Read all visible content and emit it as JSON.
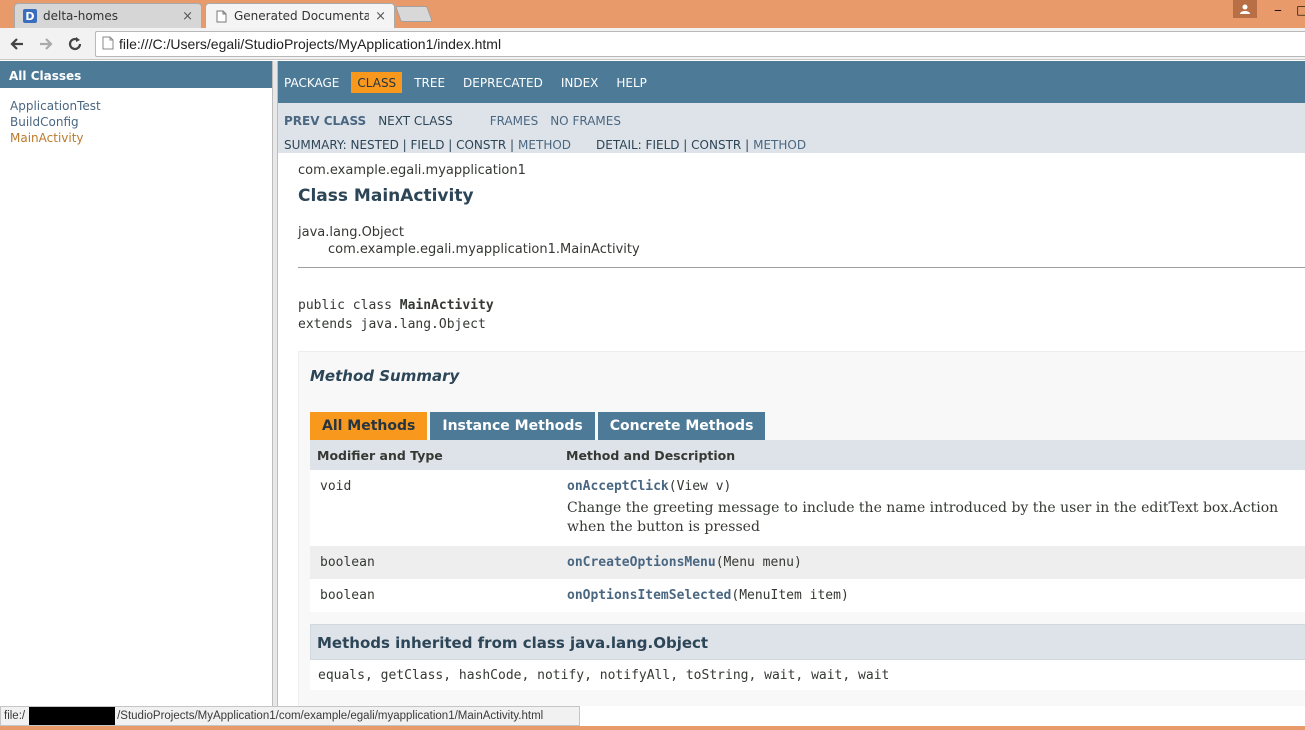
{
  "browser": {
    "tabs": [
      {
        "favicon_letter": "D",
        "title": "delta-homes",
        "close": "×"
      },
      {
        "title": "Generated Documentation",
        "close": "×"
      }
    ],
    "window_controls": {
      "minimize": "‒",
      "restore": "□"
    },
    "url": "file:///C:/Users/egali/StudioProjects/MyApplication1/index.html",
    "status_prefix": "file:/",
    "status_text": "/StudioProjects/MyApplication1/com/example/egali/myapplication1/MainActivity.html"
  },
  "left_frame": {
    "header": "All Classes",
    "classes": [
      "ApplicationTest",
      "BuildConfig",
      "MainActivity"
    ]
  },
  "topnav": {
    "items": [
      "PACKAGE",
      "CLASS",
      "TREE",
      "DEPRECATED",
      "INDEX",
      "HELP"
    ],
    "active": "CLASS"
  },
  "subnav": {
    "prev_class": "PREV CLASS",
    "next_class": "NEXT CLASS",
    "frames": "FRAMES",
    "no_frames": "NO FRAMES",
    "summary_prefix": "SUMMARY: NESTED | FIELD | CONSTR |",
    "summary_method": "METHOD",
    "detail_prefix": "DETAIL: FIELD | CONSTR |",
    "detail_method": "METHOD"
  },
  "doc": {
    "package": "com.example.egali.myapplication1",
    "class_title": "Class MainActivity",
    "inherit_root": "java.lang.Object",
    "inherit_child": "com.example.egali.myapplication1.MainActivity",
    "decl_prefix": "public class ",
    "decl_name": "MainActivity",
    "decl_extends": "extends java.lang.Object"
  },
  "method_summary": {
    "title": "Method Summary",
    "tabs": [
      "All Methods",
      "Instance Methods",
      "Concrete Methods"
    ],
    "headers": {
      "type": "Modifier and Type",
      "desc": "Method and Description"
    },
    "rows": [
      {
        "type": "void",
        "name": "onAcceptClick",
        "params": "(View v)",
        "desc": "Change the greeting message to include the name introduced by the user in the editText box.Action when the button is pressed"
      },
      {
        "type": "boolean",
        "name": "onCreateOptionsMenu",
        "params": "(Menu menu)",
        "desc": ""
      },
      {
        "type": "boolean",
        "name": "onOptionsItemSelected",
        "params": "(MenuItem item)",
        "desc": ""
      }
    ],
    "inherited_title": "Methods inherited from class java.lang.Object",
    "inherited_list": "equals, getClass, hashCode, notify, notifyAll, toString, wait, wait, wait"
  },
  "colors": {
    "nav": "#4d7a97",
    "active_tab": "#f8981d",
    "subnav": "#dee3e9",
    "tabstrip": "#e89a6a"
  }
}
